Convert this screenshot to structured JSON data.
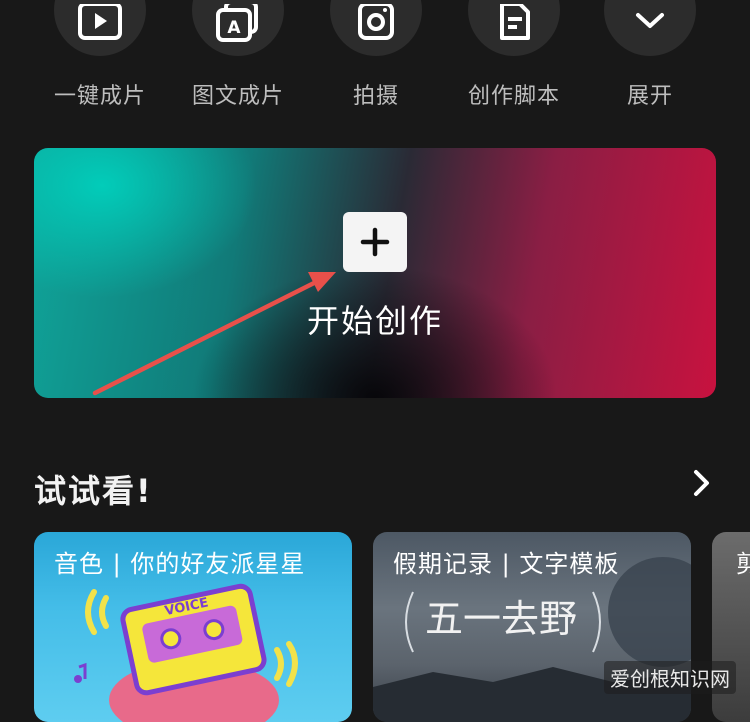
{
  "tools": [
    {
      "label": "一键成片",
      "icon": "play-icon"
    },
    {
      "label": "图文成片",
      "icon": "text-image-icon"
    },
    {
      "label": "拍摄",
      "icon": "camera-icon"
    },
    {
      "label": "创作脚本",
      "icon": "script-icon"
    },
    {
      "label": "展开",
      "icon": "chevron-down-icon"
    }
  ],
  "banner": {
    "label": "开始创作",
    "icon": "plus-icon"
  },
  "try_section": {
    "title": "试试看!",
    "more_icon": "chevron-right-icon",
    "cards": [
      {
        "title": "音色 | 你的好友派星星",
        "art_text": "VOICE"
      },
      {
        "title": "假期记录 | 文字模板",
        "art_text": "五一去野"
      },
      {
        "title": "剪"
      }
    ]
  },
  "watermark": "爱创根知识网",
  "colors": {
    "background": "#181818",
    "circle": "#2c2c2c",
    "arrow": "#e8504a"
  }
}
